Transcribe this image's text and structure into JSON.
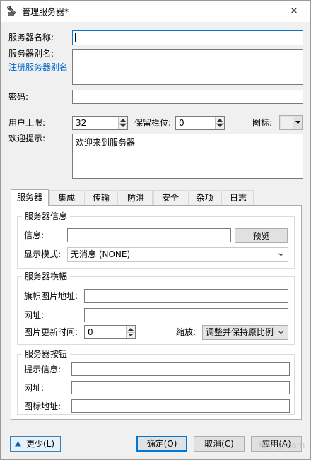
{
  "window": {
    "title": "管理服务器*",
    "close_symbol": "✕"
  },
  "form": {
    "server_name_label": "服务器名称:",
    "server_name_value": "",
    "alias_label": "服务器别名:",
    "register_alias_link": "注册服务器别名",
    "alias_value": "",
    "password_label": "密码:",
    "password_value": "",
    "user_limit_label": "用户上限:",
    "user_limit_value": "32",
    "reserved_slots_label": "保留栏位:",
    "reserved_slots_value": "0",
    "icon_label": "图标:",
    "welcome_label": "欢迎提示:",
    "welcome_value": "欢迎来到服务器"
  },
  "tabs": [
    {
      "label": "服务器",
      "active": true
    },
    {
      "label": "集成"
    },
    {
      "label": "传输"
    },
    {
      "label": "防洪"
    },
    {
      "label": "安全"
    },
    {
      "label": "杂项"
    },
    {
      "label": "日志"
    }
  ],
  "server_info": {
    "title": "服务器信息",
    "info_label": "信息:",
    "info_value": "",
    "preview_button": "预览",
    "display_mode_label": "显示模式:",
    "display_mode_value": "无消息 (NONE)"
  },
  "banner": {
    "title": "服务器横幅",
    "image_url_label": "旗帜图片地址:",
    "image_url_value": "",
    "url_label": "网址:",
    "url_value": "",
    "refresh_label": "图片更新时间:",
    "refresh_value": "0",
    "scale_label": "缩放:",
    "scale_value": "调整并保持原比例"
  },
  "server_button": {
    "title": "服务器按钮",
    "tooltip_label": "提示信息:",
    "tooltip_value": "",
    "url_label": "网址:",
    "url_value": "",
    "icon_url_label": "图标地址:",
    "icon_url_value": ""
  },
  "footer": {
    "less_button": "更少(L)",
    "ok_button": "确定(O)",
    "cancel_button": "取消(C)",
    "apply_button": "应用(A)",
    "watermark": "知乎 @ham"
  },
  "colors": {
    "accent": "#0078d7",
    "link": "#0066cc"
  }
}
